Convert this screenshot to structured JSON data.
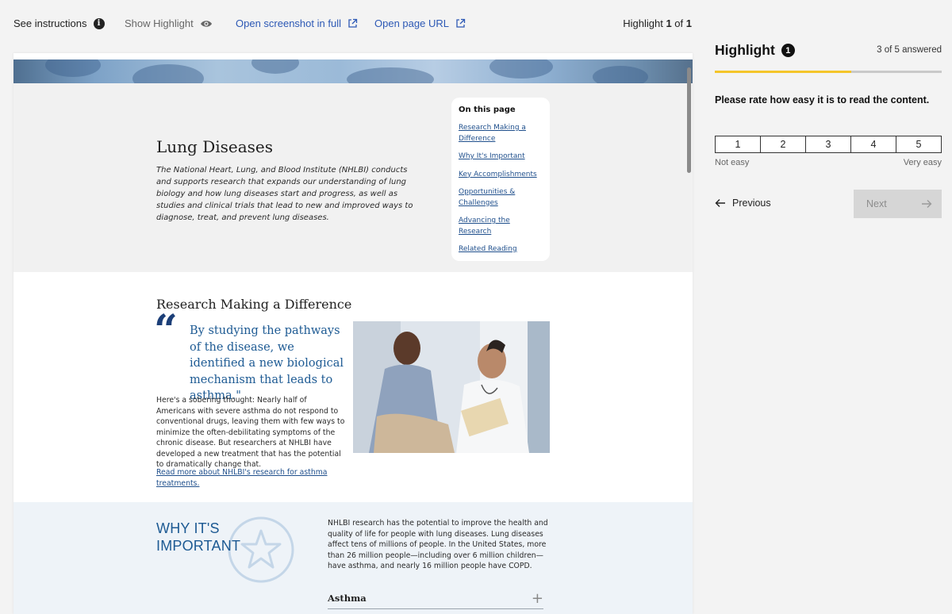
{
  "toolbar": {
    "instructions_label": "See instructions",
    "show_highlight_label": "Show Highlight",
    "open_screenshot_label": "Open screenshot in full",
    "open_url_label": "Open page URL",
    "highlight_prefix": "Highlight",
    "highlight_current": "1",
    "highlight_of": "of",
    "highlight_total": "1",
    "icons": [
      "info-icon",
      "eye-icon",
      "external-link-icon"
    ]
  },
  "screenshot": {
    "page_title": "Lung Diseases",
    "intro": "The National Heart, Lung, and Blood Institute (NHLBI) conducts and supports research that expands our understanding of lung biology and how lung diseases start and progress, as well as studies and clinical trials that lead to new and improved ways to diagnose, treat, and prevent lung diseases.",
    "toc": {
      "title": "On this page",
      "links": [
        "Research Making a Difference",
        "Why It's Important",
        "Key Accomplishments",
        "Opportunities & Challenges",
        "Advancing the Research",
        "Related Reading"
      ]
    },
    "research": {
      "title": "Research Making a Difference",
      "quote_mark": "“",
      "quote": "By studying the pathways of the disease, we identified a new biological mechanism that leads to asthma.\"",
      "body": "Here's a sobering thought: Nearly half of Americans with severe asthma do not respond to conventional drugs, leaving them with few ways to minimize the often-debilitating symptoms of the chronic disease. But researchers at NHLBI have developed a new treatment that has the potential to dramatically change that.",
      "link": "Read more about NHLBI's research for asthma treatments."
    },
    "why": {
      "title": "WHY IT'S IMPORTANT",
      "text": "NHLBI research has the potential to improve the health and quality of life for people with lung diseases. Lung diseases affect tens of millions of people. In the United States, more than 26 million people—including over 6 million children—have asthma, and nearly 16 million people have COPD.",
      "accordion_label": "Asthma",
      "accordion_toggle": "+"
    }
  },
  "panel": {
    "title": "Highlight",
    "badge": "1",
    "answered": "3 of 5 answered",
    "progress_fraction": 0.6,
    "progress_color": "#f4c52a",
    "question": "Please rate how easy it is to read the content.",
    "scale": [
      "1",
      "2",
      "3",
      "4",
      "5"
    ],
    "scale_min_label": "Not easy",
    "scale_max_label": "Very easy",
    "prev_label": "Previous",
    "next_label": "Next",
    "next_disabled": true
  },
  "colors": {
    "link": "#2d59b5",
    "heading_blue": "#1d5a93",
    "accent_yellow": "#f4c52a"
  }
}
